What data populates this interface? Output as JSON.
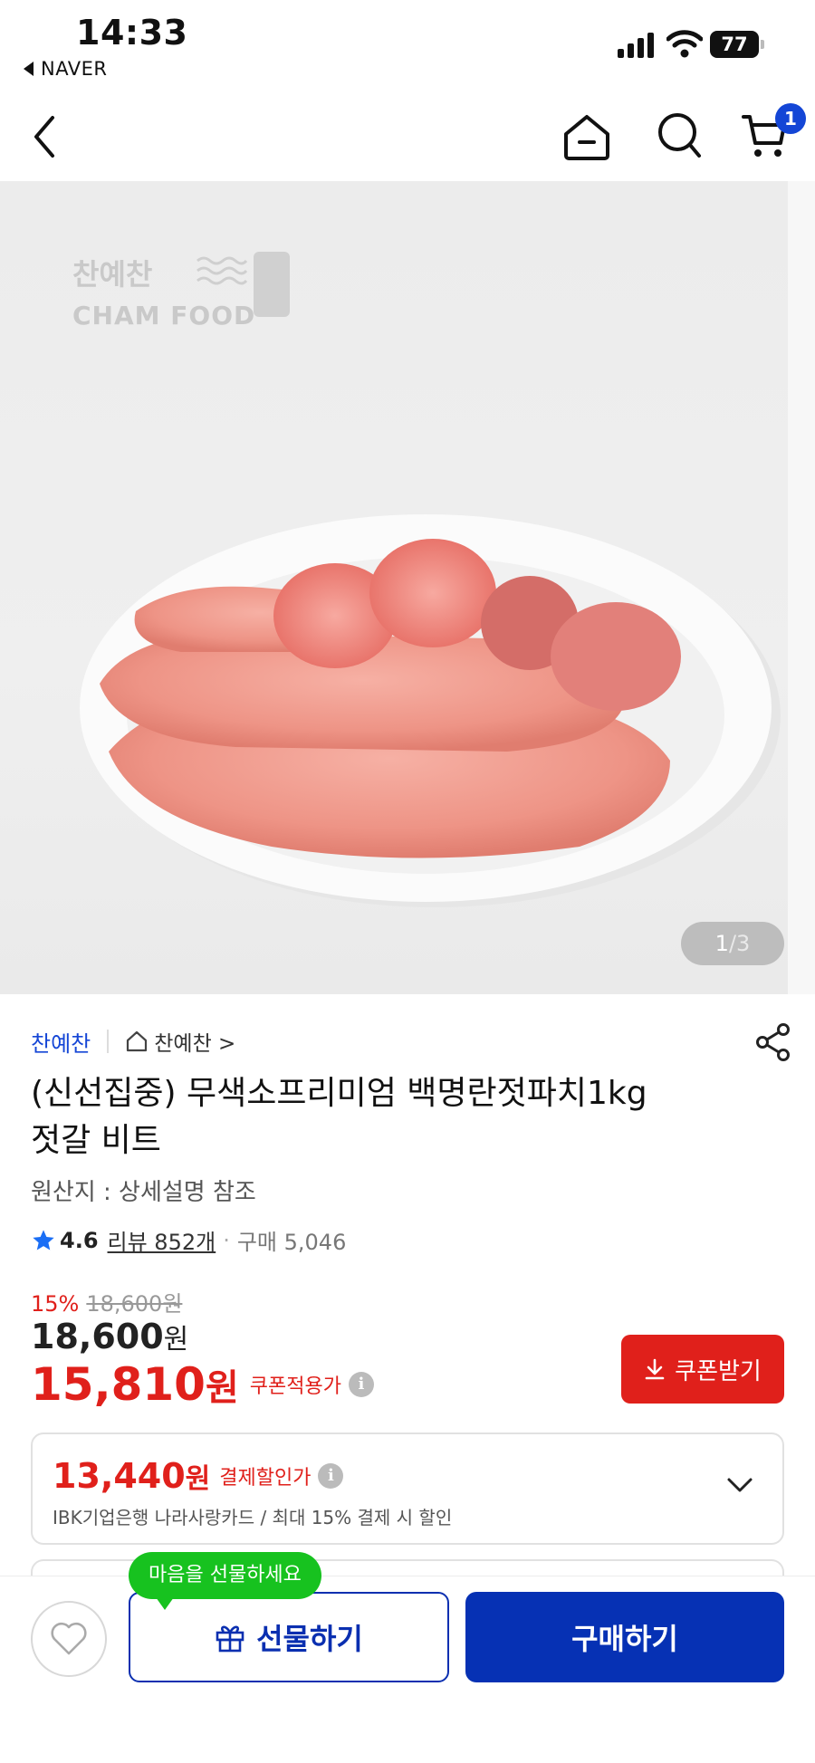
{
  "status_bar": {
    "time": "14:33",
    "back_app": "NAVER",
    "battery": "77"
  },
  "nav": {
    "cart_count": "1"
  },
  "gallery": {
    "watermark_kr": "찬예찬",
    "watermark_en": "CHAM FOOD",
    "current": "1",
    "separator": "/",
    "total": "3"
  },
  "product": {
    "store_name": "찬예찬",
    "store_link": "찬예찬 >",
    "title_line1": "(신선집중) 무색소프리미엄 백명란젓파치1kg",
    "title_line2": "젓갈 비트",
    "origin": "원산지 : 상세설명 참조",
    "rating": "4.6",
    "reviews": "리뷰 852개",
    "dot": "·",
    "purchases": "구매 5,046"
  },
  "price": {
    "discount_rate": "15%",
    "original": "18,600원",
    "sale_number": "18,600",
    "sale_won": "원",
    "coupon_number": "15,810",
    "coupon_won": "원",
    "coupon_label": "쿠폰적용가",
    "coupon_button": "쿠폰받기"
  },
  "payment": {
    "price_number": "13,440",
    "price_won": "원",
    "label": "결제할인가",
    "sub": "IBK기업은행 나라사랑카드 / 최대 15% 결제 시 할인"
  },
  "bottom": {
    "tooltip": "마음을 선물하세요",
    "gift_label": "선물하기",
    "buy_label": "구매하기"
  },
  "colors": {
    "accent_blue": "#0631b4",
    "sale_red": "#e0201b",
    "tooltip_green": "#17c21f"
  }
}
